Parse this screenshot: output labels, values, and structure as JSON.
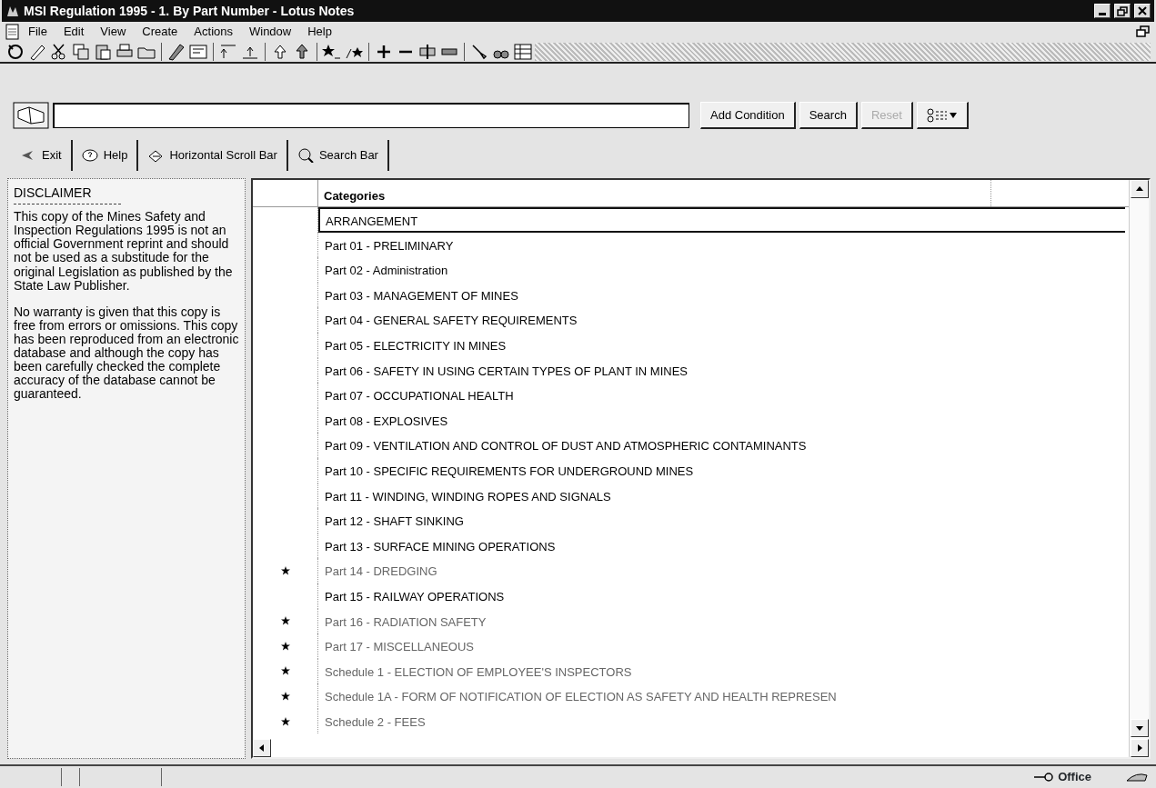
{
  "window": {
    "title": "MSI Regulation 1995 - 1. By Part Number - Lotus Notes"
  },
  "menu": [
    "File",
    "Edit",
    "View",
    "Create",
    "Actions",
    "Window",
    "Help"
  ],
  "search_bar": {
    "buttons": [
      {
        "label": "Add Condition",
        "disabled": false
      },
      {
        "label": "Search",
        "disabled": false
      },
      {
        "label": "Reset",
        "disabled": true
      }
    ]
  },
  "action_bar": [
    {
      "label": "Exit",
      "kind": "exit"
    },
    {
      "label": "Help",
      "kind": "help"
    },
    {
      "label": "Horizontal Scroll Bar",
      "kind": "scroll"
    },
    {
      "label": "Search Bar",
      "kind": "search"
    }
  ],
  "disclaimer": {
    "title": "DISCLAIMER",
    "paragraphs": [
      "This copy of the Mines Safety and Inspection Regulations 1995 is not an official Government reprint and should not be used as a substitude for the original Legislation as published by the State Law Publisher.",
      "No warranty is given that this copy is free from errors or omissions. This copy has been reproduced from an electronic database and although the copy has been carefully checked the complete accuracy of the database cannot be guaranteed."
    ]
  },
  "view": {
    "columns": [
      "Categories"
    ],
    "rows": [
      {
        "text": "ARRANGEMENT",
        "starred": false,
        "selected": true
      },
      {
        "text": "Part 01 - PRELIMINARY",
        "starred": false,
        "selected": false
      },
      {
        "text": "Part 02 - Administration",
        "starred": false,
        "selected": false
      },
      {
        "text": "Part 03 - MANAGEMENT OF MINES",
        "starred": false,
        "selected": false
      },
      {
        "text": "Part 04 - GENERAL SAFETY REQUIREMENTS",
        "starred": false,
        "selected": false
      },
      {
        "text": "Part 05 - ELECTRICITY IN MINES",
        "starred": false,
        "selected": false
      },
      {
        "text": "Part 06 - SAFETY IN USING CERTAIN TYPES OF PLANT IN MINES",
        "starred": false,
        "selected": false
      },
      {
        "text": "Part 07 - OCCUPATIONAL HEALTH",
        "starred": false,
        "selected": false
      },
      {
        "text": "Part 08 - EXPLOSIVES",
        "starred": false,
        "selected": false
      },
      {
        "text": "Part 09 - VENTILATION AND CONTROL OF DUST AND ATMOSPHERIC CONTAMINANTS",
        "starred": false,
        "selected": false
      },
      {
        "text": "Part 10 - SPECIFIC REQUIREMENTS FOR UNDERGROUND MINES",
        "starred": false,
        "selected": false
      },
      {
        "text": "Part 11 - WINDING, WINDING ROPES AND SIGNALS",
        "starred": false,
        "selected": false
      },
      {
        "text": "Part 12 - SHAFT SINKING",
        "starred": false,
        "selected": false
      },
      {
        "text": "Part 13 - SURFACE MINING OPERATIONS",
        "starred": false,
        "selected": false
      },
      {
        "text": "Part 14 - DREDGING",
        "starred": true,
        "selected": false
      },
      {
        "text": "Part 15 - RAILWAY OPERATIONS",
        "starred": false,
        "selected": false
      },
      {
        "text": "Part 16 - RADIATION SAFETY",
        "starred": true,
        "selected": false
      },
      {
        "text": "Part 17 - MISCELLANEOUS",
        "starred": true,
        "selected": false
      },
      {
        "text": "Schedule 1 - ELECTION OF EMPLOYEE'S INSPECTORS",
        "starred": true,
        "selected": false
      },
      {
        "text": "Schedule 1A - FORM OF NOTIFICATION OF ELECTION AS SAFETY AND HEALTH REPRESEN",
        "starred": true,
        "selected": false
      },
      {
        "text": "Schedule 2 - FEES",
        "starred": true,
        "selected": false
      }
    ]
  },
  "status_bar": {
    "location": "Office"
  }
}
